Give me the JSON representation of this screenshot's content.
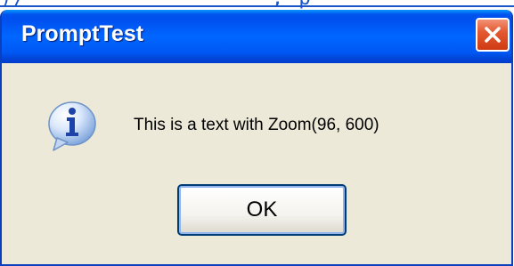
{
  "background": {
    "text": ")/                  , p                              )"
  },
  "dialog": {
    "title": "PromptTest",
    "message": "This is a text with Zoom(96, 600)",
    "icon": "info-icon",
    "ok_label": "OK",
    "close_icon": "close-icon"
  },
  "colors": {
    "titlebar": "#0058ee",
    "frame": "#0a3fbd",
    "body": "#ece9d8",
    "close_button": "#e45a33",
    "link_text": "#1a56c8"
  }
}
